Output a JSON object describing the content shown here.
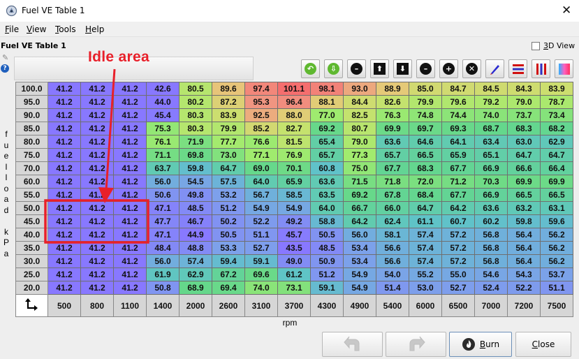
{
  "window": {
    "title": "Fuel VE Table 1",
    "close_glyph": "✕"
  },
  "menu": [
    {
      "label": "File",
      "accel": "F",
      "rest": "ile"
    },
    {
      "label": "View",
      "accel": "V",
      "rest": "iew"
    },
    {
      "label": "Tools",
      "accel": "T",
      "rest": "ools"
    },
    {
      "label": "Help",
      "accel": "H",
      "rest": "elp"
    }
  ],
  "table_name": "Fuel VE Table 1",
  "view3d": {
    "label_accel": "3",
    "label_rest": "D View",
    "checked": false
  },
  "toolbar": [
    {
      "name": "rotate-left-button",
      "icon": "arrow-left-circle-icon",
      "glyph": "↶",
      "bg": "#5fb830"
    },
    {
      "name": "rotate-right-button",
      "icon": "arrow-down-circle-icon",
      "glyph": "⇩",
      "bg": "#5fb830"
    },
    {
      "name": "decrement-button",
      "icon": "minus-circle-icon",
      "glyph": "–",
      "bg": "#111111"
    },
    {
      "name": "increase-button",
      "icon": "arrow-up-square-icon",
      "glyph": "⬆",
      "bg": "#111111",
      "square": true
    },
    {
      "name": "decrease-button",
      "icon": "arrow-down-square-icon",
      "glyph": "⬇",
      "bg": "#111111",
      "square": true
    },
    {
      "name": "subtract-button",
      "icon": "minus-circle-icon",
      "glyph": "–",
      "bg": "#111111"
    },
    {
      "name": "add-button",
      "icon": "plus-circle-icon",
      "glyph": "+",
      "bg": "#111111"
    },
    {
      "name": "multiply-button",
      "icon": "times-circle-icon",
      "glyph": "✕",
      "bg": "#111111"
    },
    {
      "name": "pen-button",
      "icon": "pen-icon",
      "glyph": "",
      "bg": ""
    },
    {
      "name": "horizontal-smooth-button",
      "icon": "horizontal-bars-icon",
      "glyph": "",
      "bg": ""
    },
    {
      "name": "vertical-smooth-button",
      "icon": "vertical-bars-icon",
      "glyph": "",
      "bg": ""
    },
    {
      "name": "color-gradient-button",
      "icon": "gradient-icon",
      "glyph": "",
      "bg": ""
    }
  ],
  "y_axis_label_chars": [
    "f",
    "u",
    "e",
    "l",
    "l",
    "o",
    "a",
    "d",
    "",
    "k",
    "P",
    "a"
  ],
  "x_axis_label": "rpm",
  "table": {
    "y_bins": [
      "100.0",
      "95.0",
      "90.0",
      "85.0",
      "80.0",
      "75.0",
      "70.0",
      "60.0",
      "55.0",
      "50.0",
      "45.0",
      "40.0",
      "35.0",
      "30.0",
      "25.0",
      "20.0"
    ],
    "x_bins": [
      "500",
      "800",
      "1100",
      "1400",
      "2000",
      "2600",
      "3100",
      "3700",
      "4300",
      "4900",
      "5400",
      "6000",
      "6500",
      "7000",
      "7200",
      "7500"
    ],
    "values": [
      [
        "41.2",
        "41.2",
        "41.2",
        "42.6",
        "80.5",
        "89.6",
        "97.4",
        "101.1",
        "98.1",
        "93.0",
        "88.9",
        "85.0",
        "84.7",
        "84.5",
        "84.3",
        "83.9"
      ],
      [
        "41.2",
        "41.2",
        "41.2",
        "44.0",
        "80.2",
        "87.2",
        "95.3",
        "96.4",
        "88.1",
        "84.4",
        "82.6",
        "79.9",
        "79.6",
        "79.2",
        "79.0",
        "78.7"
      ],
      [
        "41.2",
        "41.2",
        "41.2",
        "45.4",
        "80.3",
        "83.9",
        "92.5",
        "88.0",
        "77.0",
        "82.5",
        "76.3",
        "74.8",
        "74.4",
        "74.0",
        "73.7",
        "73.4"
      ],
      [
        "41.2",
        "41.2",
        "41.2",
        "75.3",
        "80.3",
        "79.9",
        "85.2",
        "82.7",
        "69.2",
        "80.7",
        "69.9",
        "69.7",
        "69.3",
        "68.7",
        "68.3",
        "68.2"
      ],
      [
        "41.2",
        "41.2",
        "41.2",
        "76.1",
        "71.9",
        "77.7",
        "76.6",
        "81.5",
        "65.4",
        "79.0",
        "63.6",
        "64.6",
        "64.1",
        "63.4",
        "63.0",
        "62.9"
      ],
      [
        "41.2",
        "41.2",
        "41.2",
        "71.1",
        "69.8",
        "73.0",
        "77.1",
        "76.9",
        "65.7",
        "77.3",
        "65.7",
        "66.5",
        "65.9",
        "65.1",
        "64.7",
        "64.7"
      ],
      [
        "41.2",
        "41.2",
        "41.2",
        "63.7",
        "59.8",
        "64.7",
        "69.0",
        "70.1",
        "60.8",
        "75.0",
        "67.7",
        "68.3",
        "67.7",
        "66.9",
        "66.6",
        "66.4"
      ],
      [
        "41.2",
        "41.2",
        "41.2",
        "56.0",
        "54.5",
        "57.5",
        "64.0",
        "65.9",
        "63.6",
        "71.5",
        "71.8",
        "72.0",
        "71.2",
        "70.3",
        "69.9",
        "69.9"
      ],
      [
        "41.2",
        "41.2",
        "41.2",
        "50.6",
        "49.8",
        "53.2",
        "56.7",
        "58.5",
        "63.5",
        "69.2",
        "67.8",
        "68.4",
        "67.7",
        "66.9",
        "66.5",
        "66.5"
      ],
      [
        "41.2",
        "41.2",
        "41.2",
        "47.1",
        "48.5",
        "51.2",
        "54.9",
        "54.9",
        "64.0",
        "66.7",
        "66.0",
        "64.7",
        "64.2",
        "63.6",
        "63.2",
        "63.1"
      ],
      [
        "41.2",
        "41.2",
        "41.2",
        "47.7",
        "46.7",
        "50.2",
        "52.2",
        "49.2",
        "58.8",
        "64.2",
        "62.4",
        "61.1",
        "60.7",
        "60.2",
        "59.8",
        "59.6"
      ],
      [
        "41.2",
        "41.2",
        "41.2",
        "47.1",
        "44.9",
        "50.5",
        "51.1",
        "45.7",
        "50.5",
        "56.0",
        "58.1",
        "57.4",
        "57.2",
        "56.8",
        "56.4",
        "56.2"
      ],
      [
        "41.2",
        "41.2",
        "41.2",
        "48.4",
        "48.8",
        "53.3",
        "52.7",
        "43.5",
        "48.5",
        "53.4",
        "56.6",
        "57.4",
        "57.2",
        "56.8",
        "56.4",
        "56.2"
      ],
      [
        "41.2",
        "41.2",
        "41.2",
        "56.0",
        "57.4",
        "59.4",
        "59.1",
        "49.0",
        "50.9",
        "53.4",
        "56.6",
        "57.4",
        "57.2",
        "56.8",
        "56.4",
        "56.2"
      ],
      [
        "41.2",
        "41.2",
        "41.2",
        "61.9",
        "62.9",
        "67.2",
        "69.6",
        "61.2",
        "51.2",
        "54.9",
        "54.0",
        "55.2",
        "55.0",
        "54.6",
        "54.3",
        "53.7"
      ],
      [
        "41.2",
        "41.2",
        "41.2",
        "50.8",
        "68.9",
        "69.4",
        "74.0",
        "73.1",
        "59.1",
        "54.9",
        "51.4",
        "53.0",
        "52.7",
        "52.4",
        "52.2",
        "51.1"
      ]
    ],
    "color_min": 41.2,
    "color_max": 101.1
  },
  "corner_icon": "axis-swap-icon",
  "buttons": {
    "burn": "Burn",
    "burn_accel": "B",
    "burn_rest": "urn",
    "close": "Close",
    "close_accel": "C",
    "close_rest": "lose"
  },
  "annotation": {
    "text": "Idle area",
    "color": "#e8202a"
  }
}
